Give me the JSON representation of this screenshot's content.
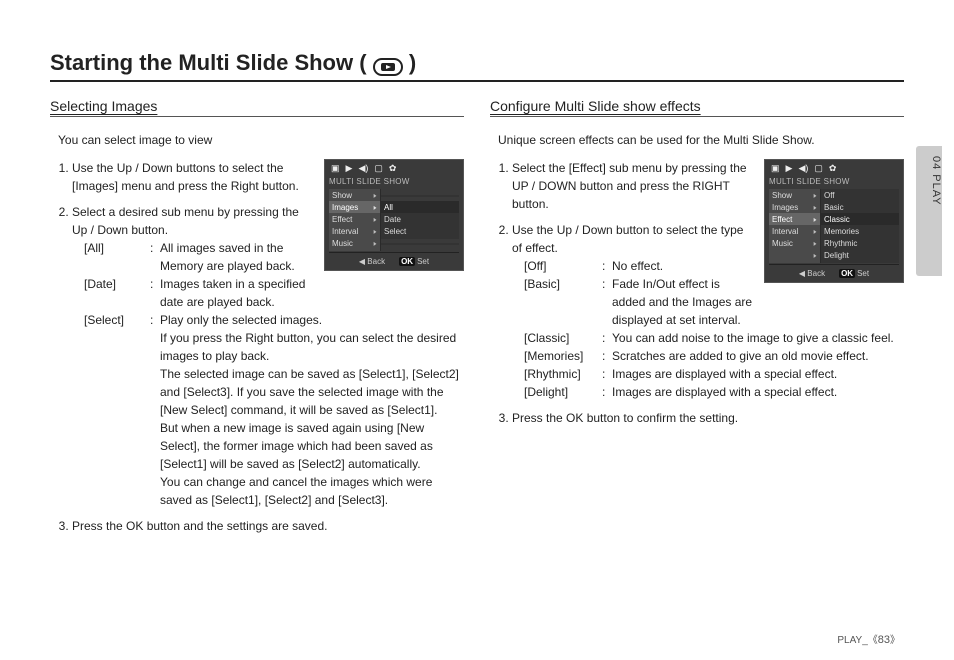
{
  "page": {
    "title_prefix": "Starting the Multi Slide Show (",
    "title_suffix": ")",
    "side_tab": "04 PLAY",
    "footer_prefix": "PLAY_",
    "page_number": "83"
  },
  "left": {
    "heading": "Selecting Images",
    "intro": "You can select image to view",
    "step1": "Use the Up / Down buttons to select the [Images] menu and press the Right button.",
    "step2": "Select a desired sub menu by pressing the Up / Down button.",
    "defs": {
      "all_term": "[All]",
      "all_desc": "All images saved in the Memory are played back.",
      "date_term": "[Date]",
      "date_desc": "Images taken in a specified date are played back.",
      "select_term": "[Select]",
      "select_desc": "Play only the selected images.",
      "select_p1": "If you press the Right button, you can select the desired images to play back.",
      "select_p2": "The selected image can be saved as [Select1], [Select2] and [Select3]. If you save the selected image with the [New Select] command, it will be saved as [Select1].",
      "select_p3": "But when a new image is saved again using [New Select], the former image which had been saved as [Select1] will be saved as [Select2] automatically.",
      "select_p4": "You can change and cancel the images which were saved as [Select1], [Select2] and [Select3]."
    },
    "step3": "Press the OK button and the settings are saved.",
    "box": {
      "title": "MULTI SLIDE SHOW",
      "rows": [
        {
          "l": "Show",
          "r": ""
        },
        {
          "l": "Images",
          "r": "All",
          "hi": true
        },
        {
          "l": "Effect",
          "r": "Date"
        },
        {
          "l": "Interval",
          "r": "Select"
        },
        {
          "l": "Music",
          "r": ""
        }
      ],
      "back": "Back",
      "set": "Set",
      "ok": "OK"
    }
  },
  "right": {
    "heading": "Configure Multi Slide show effects",
    "intro": "Unique screen effects can be used for the Multi Slide Show.",
    "step1": "Select the [Effect] sub menu by pressing the UP / DOWN button and press the RIGHT button.",
    "step2": "Use the Up / Down button to select the type of effect.",
    "defs": {
      "off_term": "[Off]",
      "off_desc": "No effect.",
      "basic_term": "[Basic]",
      "basic_desc": "Fade In/Out effect is added and the Images are displayed at set interval.",
      "classic_term": "[Classic]",
      "classic_desc": "You can add noise to the image to give a classic feel.",
      "memories_term": "[Memories]",
      "memories_desc": "Scratches are added to give an old movie effect.",
      "rhythmic_term": "[Rhythmic]",
      "rhythmic_desc": "Images are displayed with a special effect.",
      "delight_term": "[Delight]",
      "delight_desc": "Images are displayed with a special effect."
    },
    "step3": "Press the OK button to confirm the setting.",
    "box": {
      "title": "MULTI SLIDE SHOW",
      "rows": [
        {
          "l": "Show",
          "r": "Off"
        },
        {
          "l": "Images",
          "r": "Basic"
        },
        {
          "l": "Effect",
          "r": "Classic",
          "hi": true
        },
        {
          "l": "Interval",
          "r": "Memories"
        },
        {
          "l": "Music",
          "r": "Rhythmic"
        },
        {
          "l": "",
          "r": "Delight"
        }
      ],
      "back": "Back",
      "set": "Set",
      "ok": "OK"
    }
  }
}
